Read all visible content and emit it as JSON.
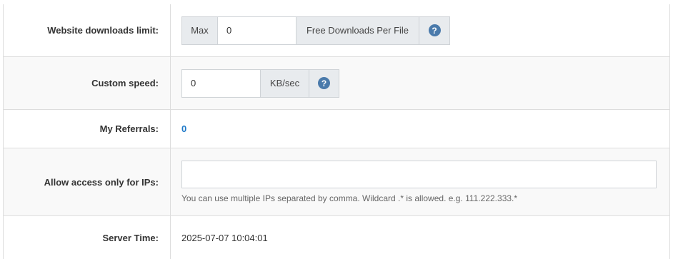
{
  "rows": {
    "downloads_limit": {
      "label": "Website downloads limit:",
      "prefix": "Max",
      "value": "0",
      "suffix": "Free Downloads Per File",
      "help_icon": "question-circle-icon"
    },
    "custom_speed": {
      "label": "Custom speed:",
      "value": "0",
      "suffix": "KB/sec",
      "help_icon": "question-circle-icon"
    },
    "referrals": {
      "label": "My Referrals:",
      "value": "0"
    },
    "allowed_ips": {
      "label": "Allow access only for IPs:",
      "value": "",
      "help_text": "You can use multiple IPs separated by comma. Wildcard .* is allowed. e.g. 111.222.333.*"
    },
    "server_time": {
      "label": "Server Time:",
      "value": "2025-07-07 10:04:01"
    }
  },
  "colors": {
    "link": "#1e79c8",
    "help_icon": "#4a7aab",
    "addon_bg": "#e8ebee",
    "border": "#dddddd"
  }
}
